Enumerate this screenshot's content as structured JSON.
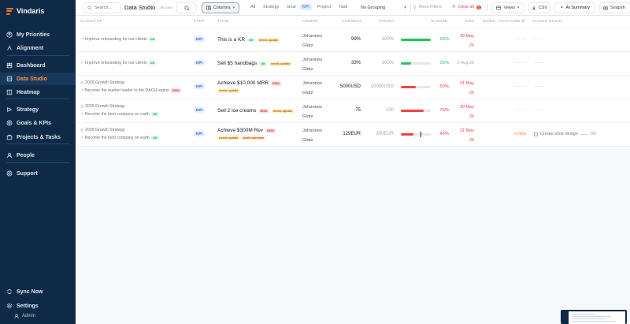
{
  "brand": {
    "name": "Vindaris"
  },
  "sidebar": {
    "items": [
      {
        "label": "My Priorities",
        "icon": "user-circle-icon"
      },
      {
        "label": "Alignment",
        "icon": "alignment-icon"
      },
      {
        "label": "Dashboard",
        "icon": "dashboard-icon"
      },
      {
        "label": "Data Studio",
        "icon": "database-icon",
        "active": true
      },
      {
        "label": "Heatmap",
        "icon": "heatmap-icon"
      },
      {
        "label": "Strategy",
        "icon": "strategy-icon"
      },
      {
        "label": "Goals & KPIs",
        "icon": "target-icon"
      },
      {
        "label": "Projects & Tasks",
        "icon": "briefcase-icon"
      },
      {
        "label": "People",
        "icon": "people-icon"
      },
      {
        "label": "Support",
        "icon": "support-icon"
      }
    ],
    "footer": [
      {
        "label": "Sync Now",
        "icon": "sync-icon"
      },
      {
        "label": "Settings",
        "icon": "gear-icon"
      }
    ],
    "admin": "Admin"
  },
  "toolbar": {
    "search_placeholder": "Search...",
    "title": "Data Studio",
    "subtitle": "All rows",
    "columns_label": "Columns",
    "filter_tabs": [
      "All",
      "Strategy",
      "Goal",
      "KPI",
      "Project",
      "Task"
    ],
    "active_tab": "KPI",
    "grouping_label": "No Grouping",
    "more_filters_label": "More Filters",
    "clear_label": "Clear all",
    "clear_count": "1",
    "views_label": "Views",
    "csv_label": "CSV",
    "ai_summary_label": "AI Summary",
    "snapshot_label": "Snapsh"
  },
  "table": {
    "headers": [
      "ALIGNS UP",
      "TYPE",
      "TITLE",
      "OWNER",
      "CURRENT",
      "TARGET",
      "% DONE",
      "DUE",
      "WORK - OUTCOME ⇅",
      "ALIGNS DOWN"
    ],
    "rows": [
      {
        "aligns_up": [
          {
            "prefix": "↗",
            "text": "Improve onboarding for our clients",
            "badge": "OK"
          }
        ],
        "type": "KPI",
        "title": "This is a KR",
        "title_badges": [
          {
            "text": "OK",
            "kind": "ok"
          },
          {
            "text": "needs update",
            "kind": "nu"
          }
        ],
        "sub_badges": [],
        "owner": [
          "Johannes",
          "Glatz"
        ],
        "current": "99%",
        "target": "100%",
        "progress": 0.99,
        "bar_color": "#22c55e",
        "pct_done": "99%",
        "pct_color": "#22c55e",
        "due": [
          "30 May",
          "26"
        ],
        "due_style": "red",
        "work_outcome": "",
        "aligns_down": ""
      },
      {
        "aligns_up": [
          {
            "prefix": "↗",
            "text": "Improve onboarding for our clients",
            "badge": "OK"
          }
        ],
        "type": "KPI",
        "title": "Sell $5 handbags",
        "title_badges": [
          {
            "text": "OK",
            "kind": "ok"
          },
          {
            "text": "needs update",
            "kind": "nu"
          }
        ],
        "sub_badges": [],
        "owner": [
          "Johannes",
          "Glatz"
        ],
        "current": "33%",
        "target": "100%",
        "progress": 0.33,
        "bar_color": "#22c55e",
        "pct_done": "33%",
        "pct_color": "#22c55e",
        "due": [
          "2 Aug 26"
        ],
        "due_style": "grey",
        "work_outcome": "",
        "aligns_down": ""
      },
      {
        "aligns_up": [
          {
            "prefix": "◎",
            "text": "2026 Growth Strategy",
            "badge": ""
          },
          {
            "prefix": "↗",
            "text": "Become the market leader in the DACH region",
            "badge": "RISK"
          }
        ],
        "type": "KPI",
        "title": "Achieve $10,000 MRR",
        "title_badges": [
          {
            "text": "RISK",
            "kind": "risk"
          }
        ],
        "sub_badges": [
          {
            "text": "needs update",
            "kind": "nu"
          }
        ],
        "owner": [
          "Johannes",
          "Glatz"
        ],
        "current": "5000USD",
        "target": "10000USD",
        "progress": 0.5,
        "bar_color": "#ef4444",
        "pct_done": "50%",
        "pct_color": "#ef4444",
        "due": [
          "31 May",
          "26"
        ],
        "due_style": "red",
        "work_outcome": "",
        "aligns_down": ""
      },
      {
        "aligns_up": [
          {
            "prefix": "◎",
            "text": "2026 Growth Strategy",
            "badge": ""
          },
          {
            "prefix": "↗",
            "text": "Become the best company on earth",
            "badge": "OK"
          }
        ],
        "type": "KPI",
        "title": "Sell 2 ice creams",
        "title_badges": [
          {
            "text": "RISK",
            "kind": "risk"
          },
          {
            "text": "needs update",
            "kind": "nu"
          }
        ],
        "sub_badges": [],
        "owner": [
          "Johannes",
          "Glatz"
        ],
        "current": "75",
        "target": "100",
        "progress": 0.75,
        "bar_color": "#ef4444",
        "pct_done": "75%",
        "pct_color": "#ef4444",
        "due": [
          "30 May",
          "26"
        ],
        "due_style": "red",
        "work_outcome": "",
        "aligns_down": ""
      },
      {
        "aligns_up": [
          {
            "prefix": "◎",
            "text": "2026 Growth Strategy",
            "badge": ""
          },
          {
            "prefix": "↗",
            "text": "Become the best company on earth",
            "badge": "OK"
          }
        ],
        "type": "KPI",
        "title": "Achieve $300M Rev",
        "title_badges": [
          {
            "text": "RISK",
            "kind": "risk"
          }
        ],
        "sub_badges": [
          {
            "text": "needs update",
            "kind": "nu"
          },
          {
            "text": "work>outcome",
            "kind": "woo"
          }
        ],
        "owner": [
          "Johannes",
          "Glatz"
        ],
        "current": "129EUR",
        "target": "300EUR",
        "progress": 0.43,
        "bar_color": "#ef4444",
        "pct_done": "43%",
        "pct_color": "#ef4444",
        "due": [
          "31 May",
          "26"
        ],
        "due_style": "red",
        "work_outcome": "+24pp",
        "aligns_down": "Create shoe design",
        "aligns_down_meta": "0/0"
      }
    ]
  }
}
